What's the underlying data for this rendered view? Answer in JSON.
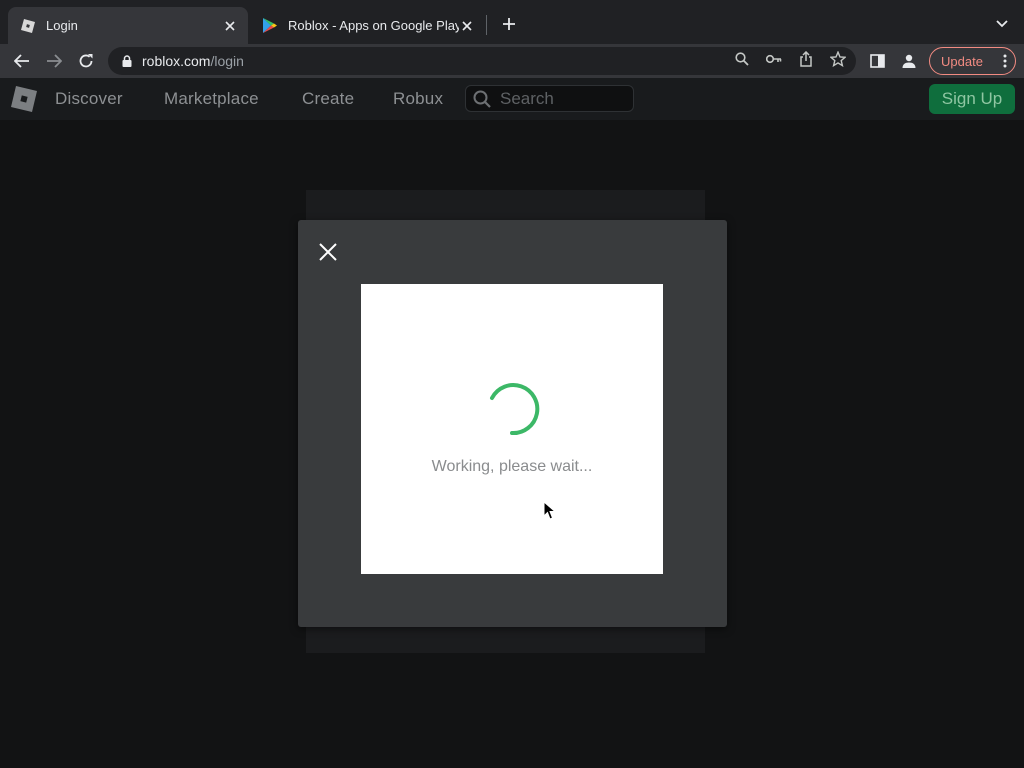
{
  "browser": {
    "tabs": [
      {
        "title": "Login",
        "active": true,
        "favicon": "roblox-favicon"
      },
      {
        "title": "Roblox - Apps on Google Play",
        "active": false,
        "favicon": "google-play-favicon"
      }
    ],
    "url_host": "roblox.com",
    "url_path": "/login",
    "update_label": "Update"
  },
  "header": {
    "nav": [
      "Discover",
      "Marketplace",
      "Create",
      "Robux"
    ],
    "search_placeholder": "Search",
    "signup_label": "Sign Up"
  },
  "modal": {
    "status_text": "Working, please wait...",
    "spinner_color": "#3cb867"
  },
  "colors": {
    "accent_green": "#0f6e3d",
    "update_red": "#f28b82"
  }
}
